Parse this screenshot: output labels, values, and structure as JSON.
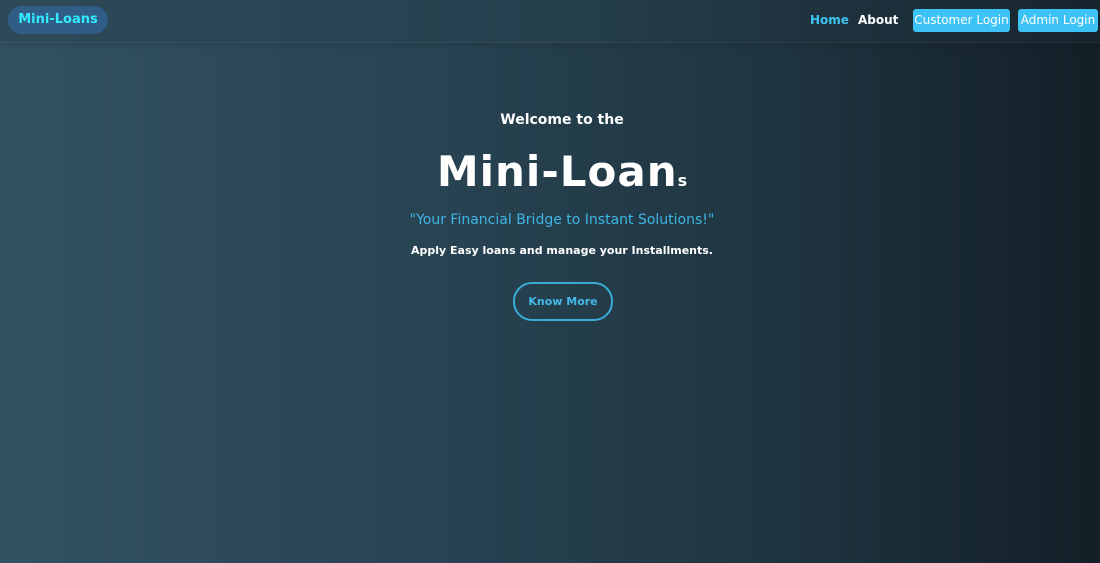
{
  "navbar": {
    "brand": "Mini-Loans",
    "links": [
      {
        "label": "Home",
        "active": true
      },
      {
        "label": "About",
        "active": false
      }
    ],
    "buttons": {
      "customer_login": "Customer Login",
      "admin_login": "Admin Login"
    }
  },
  "hero": {
    "welcome": "Welcome to the",
    "title_main": "Mini-Loan",
    "title_suffix": "s",
    "tagline": "\"Your Financial Bridge to Instant Solutions!\"",
    "subtext": "Apply Easy loans and manage your Installments.",
    "cta": "Know More"
  },
  "colors": {
    "accent": "#3dc2f5",
    "brand_text": "#33eaff",
    "brand_bg": "#2f5d86",
    "background_start": "#325262",
    "background_end": "#141f27"
  }
}
